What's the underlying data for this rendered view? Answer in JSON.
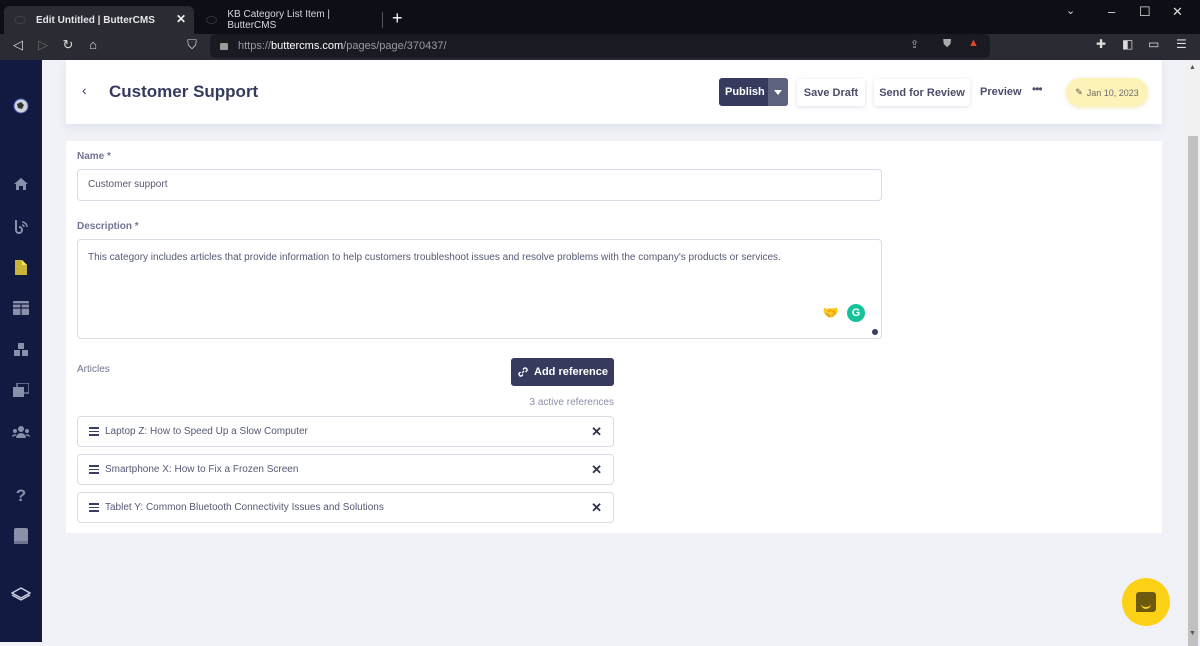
{
  "browser": {
    "tabs": [
      {
        "title": "Edit Untitled | ButterCMS",
        "active": true
      },
      {
        "title": "KB Category List Item | ButterCMS",
        "active": false
      }
    ],
    "url": {
      "scheme": "https://",
      "host": "buttercms.com",
      "path": "/pages/page/370437/"
    },
    "icons": [
      "back-icon",
      "forward-icon",
      "reload-icon",
      "home-icon",
      "bookmark-icon",
      "share-icon",
      "brave-shield-icon",
      "brave-rewards-icon",
      "extensions-icon",
      "sidebar-icon",
      "wallet-icon",
      "menu-icon"
    ]
  },
  "sidebar": {
    "items": [
      {
        "icon": "globe-avatar-icon"
      },
      {
        "icon": "home-icon"
      },
      {
        "icon": "blog-icon"
      },
      {
        "icon": "pages-icon",
        "active": true
      },
      {
        "icon": "collections-icon"
      },
      {
        "icon": "components-icon"
      },
      {
        "icon": "media-icon"
      },
      {
        "icon": "users-icon"
      },
      {
        "icon": "help-icon"
      },
      {
        "icon": "docs-icon"
      },
      {
        "icon": "layers-icon"
      }
    ]
  },
  "header": {
    "title": "Customer Support",
    "publish_label": "Publish",
    "save_draft_label": "Save Draft",
    "send_review_label": "Send for Review",
    "preview_label": "Preview",
    "more_label": "•••",
    "date_label": "Jan 10, 2023"
  },
  "form": {
    "name_label": "Name *",
    "name_value": "Customer support",
    "description_label": "Description *",
    "description_value": "This category includes articles that provide information to help customers troubleshoot issues and resolve problems with the company's products or services.",
    "articles_label": "Articles",
    "add_reference_label": "Add reference",
    "active_references": "3 active references",
    "references": [
      {
        "title": "Laptop Z: How to Speed Up a Slow Computer"
      },
      {
        "title": "Smartphone X: How to Fix a Frozen Screen"
      },
      {
        "title": "Tablet Y: Common Bluetooth Connectivity Issues and Solutions"
      }
    ]
  },
  "colors": {
    "brand_navy": "#363b5e",
    "sidebar_bg": "#131a42",
    "date_pill": "#fdf3b8",
    "chat_button": "#fcd116"
  }
}
